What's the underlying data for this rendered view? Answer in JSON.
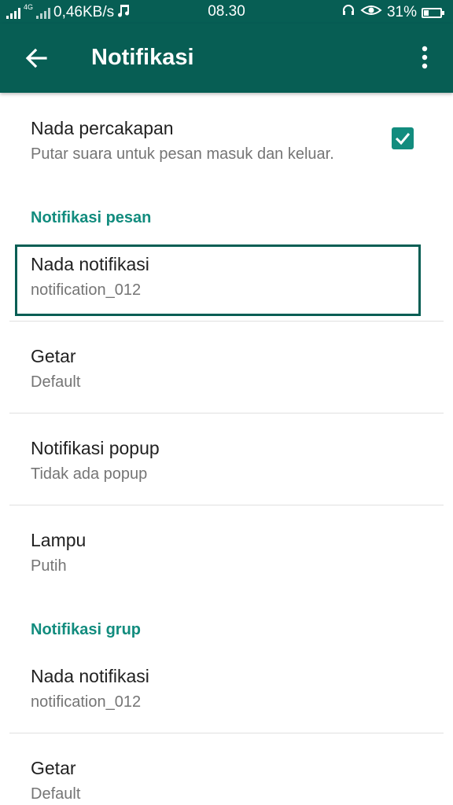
{
  "status_bar": {
    "net_speed": "0,46KB/s",
    "network_type": "4G",
    "time": "08.30",
    "battery_percent": "31%",
    "battery_level": 0.31,
    "icons": [
      "signal-icon",
      "music-note-icon",
      "headset-icon",
      "eye-icon",
      "battery-icon"
    ]
  },
  "app_bar": {
    "title": "Notifikasi",
    "icons": [
      "back-arrow-icon",
      "more-vert-icon"
    ]
  },
  "conversation_tone": {
    "title": "Nada percakapan",
    "subtitle": "Putar suara untuk pesan masuk dan keluar.",
    "checked": true
  },
  "message_section": {
    "header": "Notifikasi pesan",
    "items": [
      {
        "title": "Nada notifikasi",
        "subtitle": "notification_012"
      },
      {
        "title": "Getar",
        "subtitle": "Default"
      },
      {
        "title": "Notifikasi popup",
        "subtitle": "Tidak ada popup"
      },
      {
        "title": "Lampu",
        "subtitle": "Putih"
      }
    ]
  },
  "group_section": {
    "header": "Notifikasi grup",
    "items": [
      {
        "title": "Nada notifikasi",
        "subtitle": "notification_012"
      },
      {
        "title": "Getar",
        "subtitle": "Default"
      }
    ]
  },
  "colors": {
    "primary": "#075e54",
    "accent": "#128c7e"
  }
}
